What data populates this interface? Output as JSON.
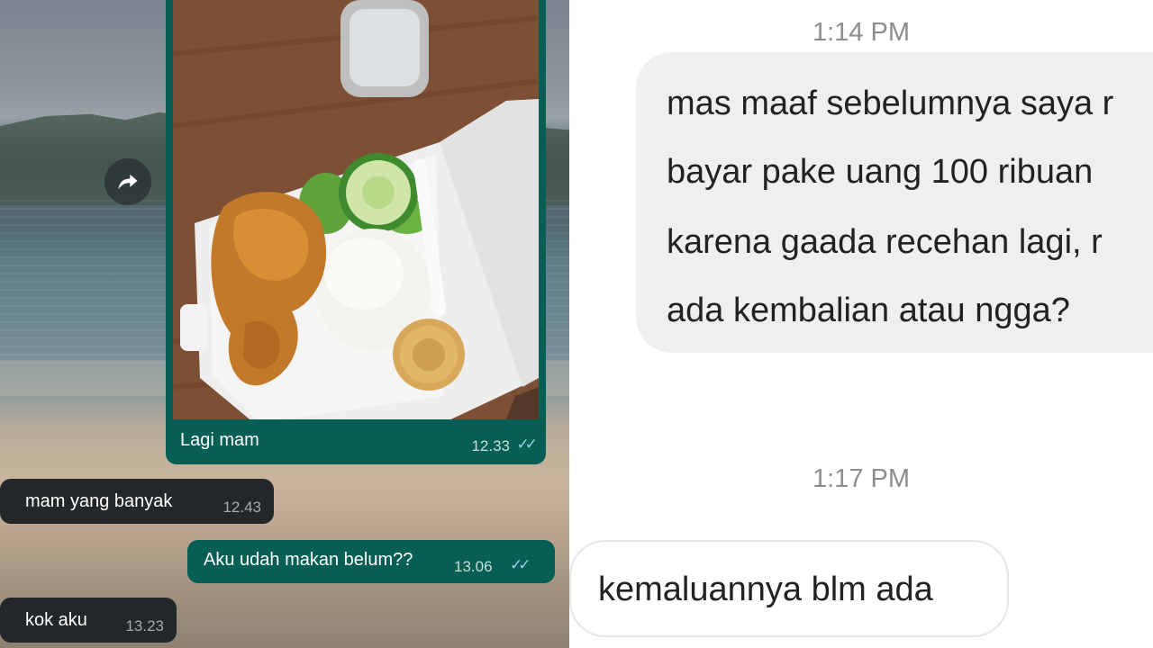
{
  "left_chat": {
    "photo_message": {
      "caption": "Lagi mam",
      "time": "12.33",
      "ticks": "✓✓"
    },
    "messages": [
      {
        "direction": "in",
        "text": "mam yang banyak",
        "time": "12.43"
      },
      {
        "direction": "out",
        "text": "Aku udah makan belum??",
        "time": "13.06",
        "ticks": "✓✓"
      },
      {
        "direction": "in",
        "text": "kok aku",
        "time": "13.23"
      }
    ],
    "forward_icon": "share-arrow-icon"
  },
  "right_chat": {
    "timestamp_1": "1:14 PM",
    "message_1_lines": [
      "mas maaf sebelumnya saya r",
      "bayar pake uang 100 ribuan",
      "karena gaada recehan lagi, r",
      "ada kembalian atau ngga?"
    ],
    "timestamp_2": "1:17 PM",
    "message_2": "kemaluannya blm ada"
  },
  "colors": {
    "outgoing_bubble": "#075e54",
    "incoming_bubble": "#23272a",
    "gray_bubble": "#efefef"
  }
}
